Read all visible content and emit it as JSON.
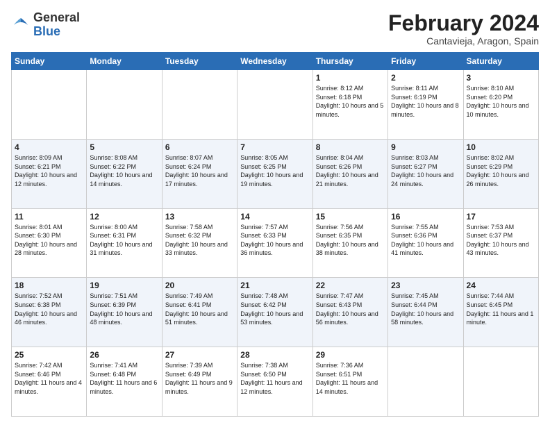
{
  "logo": {
    "general": "General",
    "blue": "Blue"
  },
  "header": {
    "title": "February 2024",
    "subtitle": "Cantavieja, Aragon, Spain"
  },
  "weekdays": [
    "Sunday",
    "Monday",
    "Tuesday",
    "Wednesday",
    "Thursday",
    "Friday",
    "Saturday"
  ],
  "weeks": [
    [
      {
        "day": "",
        "info": ""
      },
      {
        "day": "",
        "info": ""
      },
      {
        "day": "",
        "info": ""
      },
      {
        "day": "",
        "info": ""
      },
      {
        "day": "1",
        "info": "Sunrise: 8:12 AM\nSunset: 6:18 PM\nDaylight: 10 hours and 5 minutes."
      },
      {
        "day": "2",
        "info": "Sunrise: 8:11 AM\nSunset: 6:19 PM\nDaylight: 10 hours and 8 minutes."
      },
      {
        "day": "3",
        "info": "Sunrise: 8:10 AM\nSunset: 6:20 PM\nDaylight: 10 hours and 10 minutes."
      }
    ],
    [
      {
        "day": "4",
        "info": "Sunrise: 8:09 AM\nSunset: 6:21 PM\nDaylight: 10 hours and 12 minutes."
      },
      {
        "day": "5",
        "info": "Sunrise: 8:08 AM\nSunset: 6:22 PM\nDaylight: 10 hours and 14 minutes."
      },
      {
        "day": "6",
        "info": "Sunrise: 8:07 AM\nSunset: 6:24 PM\nDaylight: 10 hours and 17 minutes."
      },
      {
        "day": "7",
        "info": "Sunrise: 8:05 AM\nSunset: 6:25 PM\nDaylight: 10 hours and 19 minutes."
      },
      {
        "day": "8",
        "info": "Sunrise: 8:04 AM\nSunset: 6:26 PM\nDaylight: 10 hours and 21 minutes."
      },
      {
        "day": "9",
        "info": "Sunrise: 8:03 AM\nSunset: 6:27 PM\nDaylight: 10 hours and 24 minutes."
      },
      {
        "day": "10",
        "info": "Sunrise: 8:02 AM\nSunset: 6:29 PM\nDaylight: 10 hours and 26 minutes."
      }
    ],
    [
      {
        "day": "11",
        "info": "Sunrise: 8:01 AM\nSunset: 6:30 PM\nDaylight: 10 hours and 28 minutes."
      },
      {
        "day": "12",
        "info": "Sunrise: 8:00 AM\nSunset: 6:31 PM\nDaylight: 10 hours and 31 minutes."
      },
      {
        "day": "13",
        "info": "Sunrise: 7:58 AM\nSunset: 6:32 PM\nDaylight: 10 hours and 33 minutes."
      },
      {
        "day": "14",
        "info": "Sunrise: 7:57 AM\nSunset: 6:33 PM\nDaylight: 10 hours and 36 minutes."
      },
      {
        "day": "15",
        "info": "Sunrise: 7:56 AM\nSunset: 6:35 PM\nDaylight: 10 hours and 38 minutes."
      },
      {
        "day": "16",
        "info": "Sunrise: 7:55 AM\nSunset: 6:36 PM\nDaylight: 10 hours and 41 minutes."
      },
      {
        "day": "17",
        "info": "Sunrise: 7:53 AM\nSunset: 6:37 PM\nDaylight: 10 hours and 43 minutes."
      }
    ],
    [
      {
        "day": "18",
        "info": "Sunrise: 7:52 AM\nSunset: 6:38 PM\nDaylight: 10 hours and 46 minutes."
      },
      {
        "day": "19",
        "info": "Sunrise: 7:51 AM\nSunset: 6:39 PM\nDaylight: 10 hours and 48 minutes."
      },
      {
        "day": "20",
        "info": "Sunrise: 7:49 AM\nSunset: 6:41 PM\nDaylight: 10 hours and 51 minutes."
      },
      {
        "day": "21",
        "info": "Sunrise: 7:48 AM\nSunset: 6:42 PM\nDaylight: 10 hours and 53 minutes."
      },
      {
        "day": "22",
        "info": "Sunrise: 7:47 AM\nSunset: 6:43 PM\nDaylight: 10 hours and 56 minutes."
      },
      {
        "day": "23",
        "info": "Sunrise: 7:45 AM\nSunset: 6:44 PM\nDaylight: 10 hours and 58 minutes."
      },
      {
        "day": "24",
        "info": "Sunrise: 7:44 AM\nSunset: 6:45 PM\nDaylight: 11 hours and 1 minute."
      }
    ],
    [
      {
        "day": "25",
        "info": "Sunrise: 7:42 AM\nSunset: 6:46 PM\nDaylight: 11 hours and 4 minutes."
      },
      {
        "day": "26",
        "info": "Sunrise: 7:41 AM\nSunset: 6:48 PM\nDaylight: 11 hours and 6 minutes."
      },
      {
        "day": "27",
        "info": "Sunrise: 7:39 AM\nSunset: 6:49 PM\nDaylight: 11 hours and 9 minutes."
      },
      {
        "day": "28",
        "info": "Sunrise: 7:38 AM\nSunset: 6:50 PM\nDaylight: 11 hours and 12 minutes."
      },
      {
        "day": "29",
        "info": "Sunrise: 7:36 AM\nSunset: 6:51 PM\nDaylight: 11 hours and 14 minutes."
      },
      {
        "day": "",
        "info": ""
      },
      {
        "day": "",
        "info": ""
      }
    ]
  ]
}
